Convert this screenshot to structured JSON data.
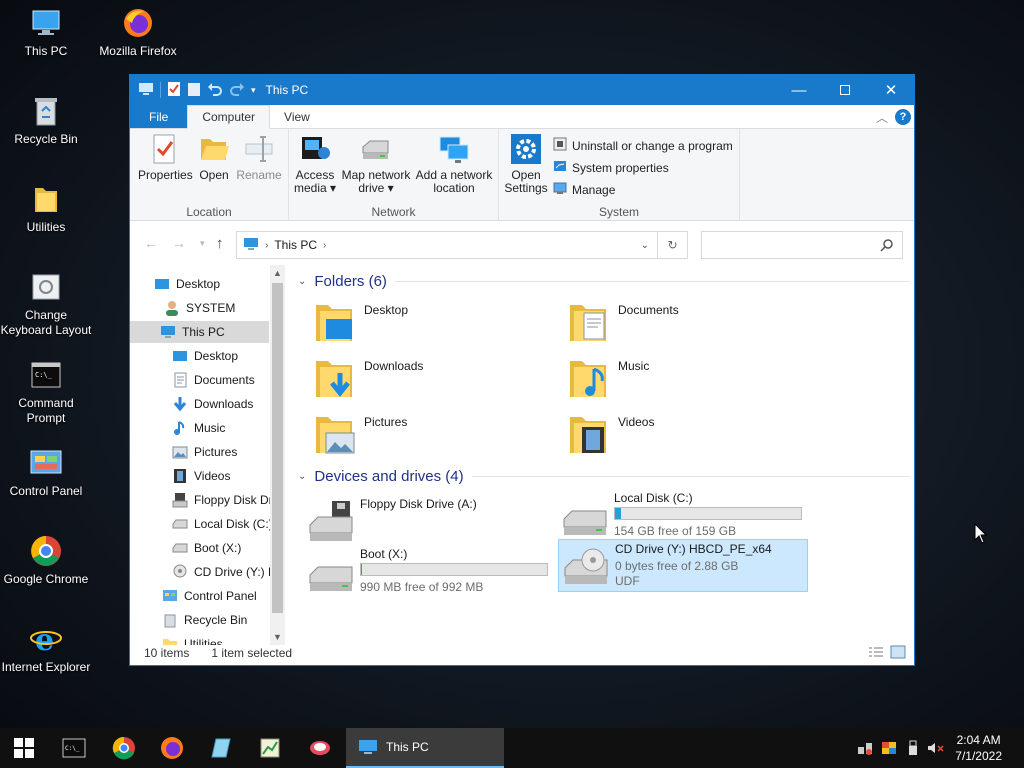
{
  "desktop": {
    "icons": [
      {
        "label": "This PC",
        "icon": "this-pc-icon"
      },
      {
        "label": "Mozilla Firefox",
        "icon": "firefox-icon"
      },
      {
        "label": "Recycle Bin",
        "icon": "recycle-bin-icon"
      },
      {
        "label": "Utilities",
        "icon": "folder-icon"
      },
      {
        "label_line1": "Change",
        "label_line2": "Keyboard Layout",
        "icon": "keyboard-icon"
      },
      {
        "label_line1": "Command",
        "label_line2": "Prompt",
        "icon": "cmd-icon"
      },
      {
        "label": "Control Panel",
        "icon": "control-panel-icon"
      },
      {
        "label": "Google Chrome",
        "icon": "chrome-icon"
      },
      {
        "label": "Internet Explorer",
        "icon": "ie-icon"
      }
    ]
  },
  "window": {
    "title": "This PC",
    "help": "?"
  },
  "ribbon": {
    "tabs": [
      "File",
      "Computer",
      "View"
    ],
    "location": {
      "title": "Location",
      "properties": "Properties",
      "open": "Open",
      "rename": "Rename"
    },
    "network": {
      "title": "Network",
      "access_media_1": "Access",
      "access_media_2": "media",
      "map_drive_1": "Map network",
      "map_drive_2": "drive",
      "add_location_1": "Add a network",
      "add_location_2": "location"
    },
    "system": {
      "title": "System",
      "open_settings_1": "Open",
      "open_settings_2": "Settings",
      "uninstall": "Uninstall or change a program",
      "system_properties": "System properties",
      "manage": "Manage"
    }
  },
  "address": {
    "crumb": "This PC",
    "search_placeholder": ""
  },
  "nav": {
    "items": [
      {
        "label": "Desktop"
      },
      {
        "label": "SYSTEM"
      },
      {
        "label": "This PC"
      },
      {
        "label": "Desktop"
      },
      {
        "label": "Documents"
      },
      {
        "label": "Downloads"
      },
      {
        "label": "Music"
      },
      {
        "label": "Pictures"
      },
      {
        "label": "Videos"
      },
      {
        "label": "Floppy Disk Dri"
      },
      {
        "label": "Local Disk (C:)"
      },
      {
        "label": "Boot (X:)"
      },
      {
        "label": "CD Drive (Y:) H"
      },
      {
        "label": "Control Panel"
      },
      {
        "label": "Recycle Bin"
      },
      {
        "label": "Utilities"
      }
    ]
  },
  "content": {
    "folders_header": "Folders (6)",
    "folders": [
      "Desktop",
      "Documents",
      "Downloads",
      "Music",
      "Pictures",
      "Videos"
    ],
    "devices_header": "Devices and drives (4)",
    "drives": [
      {
        "name": "Floppy Disk Drive (A:)"
      },
      {
        "name": "Local Disk (C:)",
        "free": "154 GB free of 159 GB",
        "used_fraction": 0.03
      },
      {
        "name": "Boot (X:)",
        "free": "990 MB free of 992 MB",
        "used_fraction": 0.002
      },
      {
        "name": "CD Drive (Y:) HBCD_PE_x64",
        "free": "0 bytes free of 2.88 GB",
        "fs": "UDF"
      }
    ]
  },
  "status": {
    "count": "10 items",
    "selected": "1 item selected"
  },
  "taskbar": {
    "active_window": "This PC",
    "time": "2:04 AM",
    "date": "7/1/2022"
  }
}
